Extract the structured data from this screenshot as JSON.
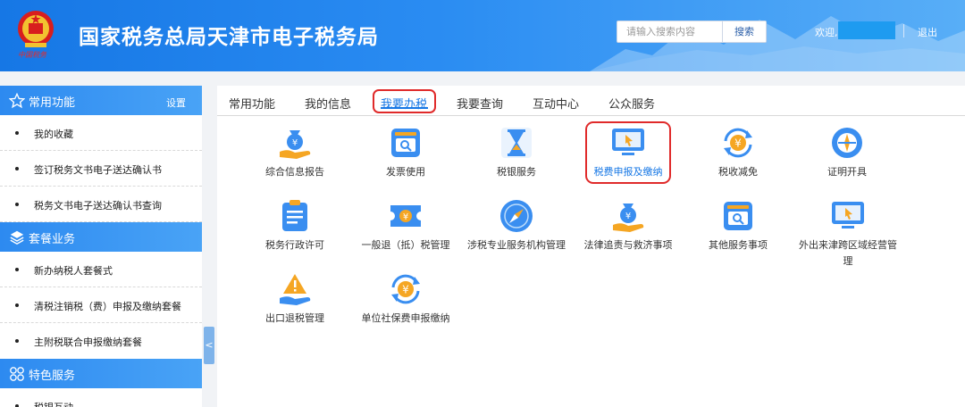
{
  "header": {
    "emblem_icon": "national-emblem-icon",
    "emblem_text": "中国税务",
    "title": "国家税务总局天津市电子税务局",
    "search_placeholder": "请输入搜索内容",
    "search_label": "搜索",
    "welcome": "欢迎,",
    "logout": "退出"
  },
  "sidebar": {
    "common": {
      "title": "常用功能",
      "settings": "设置",
      "icon": "star-icon"
    },
    "common_items": [
      "我的收藏",
      "签订税务文书电子送达确认书",
      "税务文书电子送达确认书查询"
    ],
    "package": {
      "title": "套餐业务",
      "icon": "layers-icon"
    },
    "package_items": [
      "新办纳税人套餐式",
      "清税注销税（费）申报及缴纳套餐",
      "主附税联合申报缴纳套餐"
    ],
    "special": {
      "title": "特色服务",
      "icon": "grid-icon"
    },
    "special_items": [
      "税银互动"
    ],
    "collapse_glyph": "<"
  },
  "tabs": [
    {
      "label": "常用功能",
      "active": false
    },
    {
      "label": "我的信息",
      "active": false
    },
    {
      "label": "我要办税",
      "active": true
    },
    {
      "label": "我要查询",
      "active": false
    },
    {
      "label": "互动中心",
      "active": false
    },
    {
      "label": "公众服务",
      "active": false
    }
  ],
  "services": [
    {
      "label": "综合信息报告",
      "icon": "money-bag-hand-icon"
    },
    {
      "label": "发票使用",
      "icon": "invoice-screen-icon"
    },
    {
      "label": "税银服务",
      "icon": "hourglass-icon"
    },
    {
      "label": "税费申报及缴纳",
      "icon": "monitor-cursor-icon",
      "highlighted": true
    },
    {
      "label": "税收减免",
      "icon": "yuan-refresh-icon"
    },
    {
      "label": "证明开具",
      "icon": "certificate-compass-icon"
    },
    {
      "label": "税务行政许可",
      "icon": "clipboard-icon"
    },
    {
      "label": "一般退（抵）税管理",
      "icon": "yuan-ticket-icon"
    },
    {
      "label": "涉税专业服务机构管理",
      "icon": "compass-icon"
    },
    {
      "label": "法律追责与救济事项",
      "icon": "money-bag-hand-icon"
    },
    {
      "label": "其他服务事项",
      "icon": "search-screen-icon"
    },
    {
      "label": "外出来津跨区域经营管理",
      "icon": "monitor-cursor-icon"
    },
    {
      "label": "出口退税管理",
      "icon": "warning-hand-icon"
    },
    {
      "label": "单位社保费申报缴纳",
      "icon": "yuan-refresh-icon"
    }
  ],
  "colors": {
    "brand": "#1677e5",
    "icon_blue": "#3a8ef0",
    "icon_orange": "#f5a623",
    "highlight_red": "#e02a2a"
  }
}
